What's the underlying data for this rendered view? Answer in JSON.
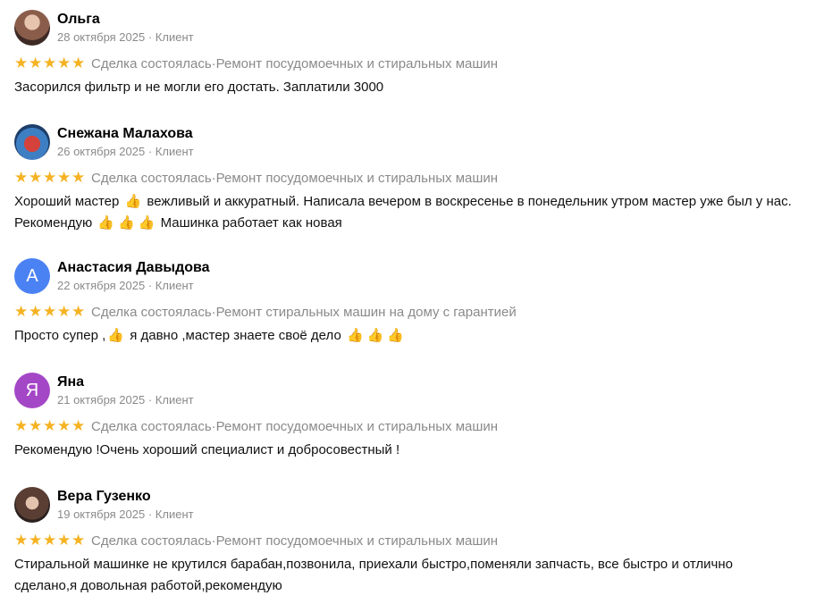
{
  "reviews": [
    {
      "name": "Ольга",
      "date": "28 октября 2025",
      "role": "Клиент",
      "status": "Сделка состоялась",
      "service": "Ремонт посудомоечных и стиральных машин",
      "text": "Засорился фильтр и не могли его достать. Заплатили 3000",
      "avatar": "photo"
    },
    {
      "name": "Снежана Малахова",
      "date": "26 октября 2025",
      "role": "Клиент",
      "status": "Сделка состоялась",
      "service": "Ремонт посудомоечных и стиральных машин",
      "text_parts": [
        "Хороший мастер",
        "вежливый и аккуратный. Написала вечером в воскресенье в понедельник утром мастер уже был у нас.",
        "Рекомендую",
        "Машинка работает как новая"
      ],
      "avatar": "photo"
    },
    {
      "name": "Анастасия Давыдова",
      "date": "22 октября 2025",
      "role": "Клиент",
      "status": "Сделка состоялась",
      "service": "Ремонт стиральных машин на дому с гарантией",
      "text_parts": [
        "Просто супер ,",
        "я давно ,мастер знаете своё дело"
      ],
      "avatar_letter": "А",
      "avatar_color": "#4b82f3"
    },
    {
      "name": "Яна",
      "date": "21 октября 2025",
      "role": "Клиент",
      "status": "Сделка состоялась",
      "service": "Ремонт посудомоечных и стиральных машин",
      "text": "Рекомендую !Очень хороший специалист и добросовестный !",
      "avatar_letter": "Я",
      "avatar_color": "#a447c6"
    },
    {
      "name": "Вера Гузенко",
      "date": "19 октября 2025",
      "role": "Клиент",
      "status": "Сделка состоялась",
      "service": "Ремонт посудомоечных и стиральных машин",
      "text_lines": [
        "Стиральной машинке не крутился барабан,позвонила, приехали быстро,поменяли запчасть, все быстро и отлично",
        "сделано,я довольная работой,рекомендую"
      ],
      "avatar": "photo"
    }
  ],
  "separator": " · ",
  "stars": "★",
  "thumb_emoji": "👍",
  "colors": {
    "star": "#f5b323",
    "muted": "#8a8a8a"
  }
}
